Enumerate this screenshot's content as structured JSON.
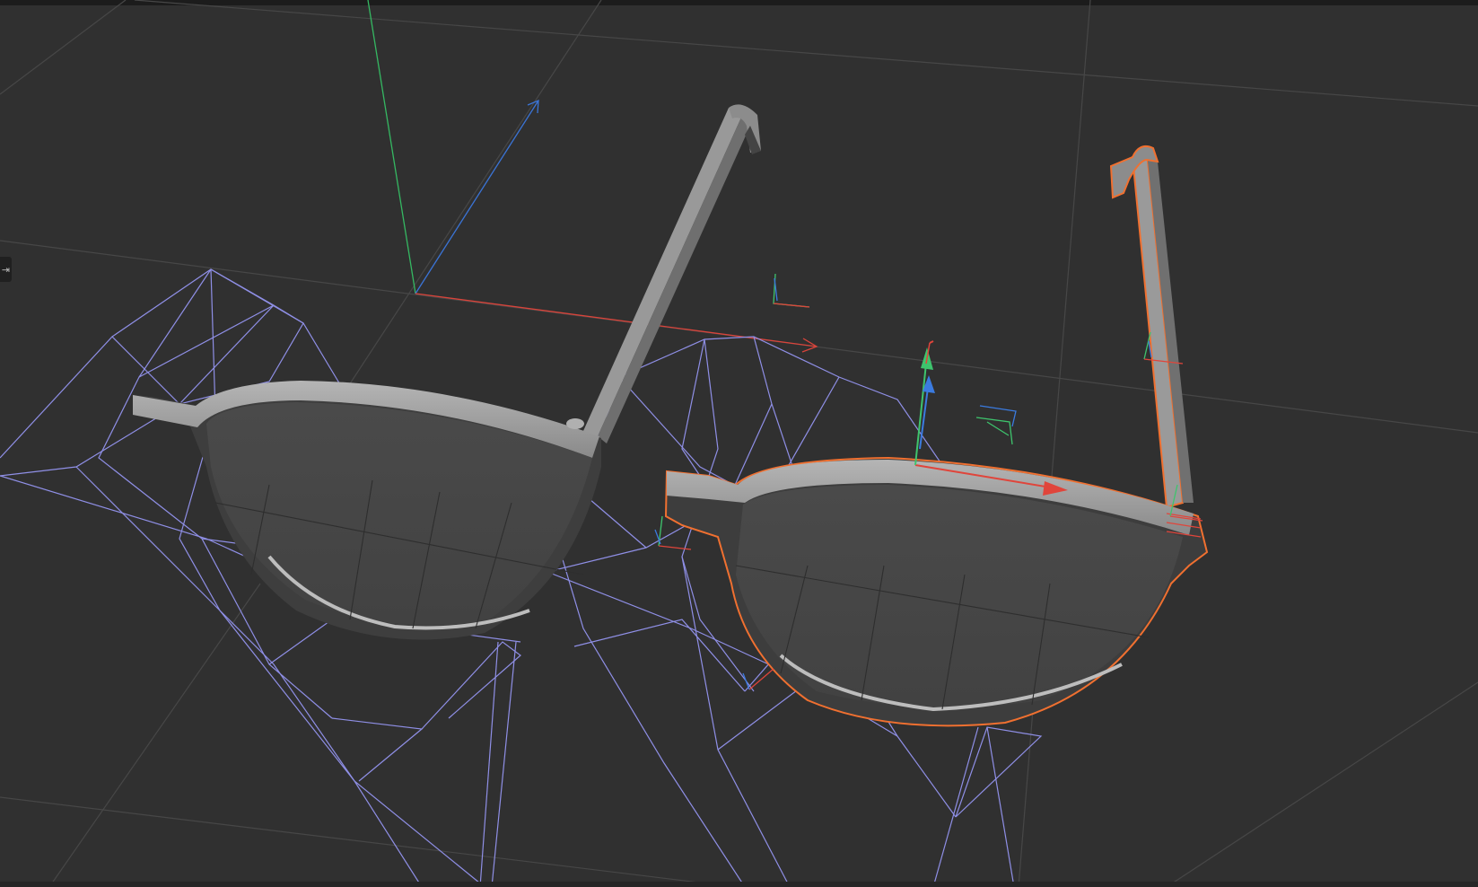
{
  "viewport": {
    "name": "3D Viewport",
    "background": "#303030"
  },
  "panel_toggle": {
    "icon": "arrow-right-to-line-icon",
    "glyph": "⇥"
  },
  "colors": {
    "grid": "#454545",
    "axis_x": "#e0453b",
    "axis_y": "#3ec46d",
    "axis_z": "#3b7be0",
    "wireframe": "#8f8fe6",
    "selection_outline": "#f07030",
    "frame_light": "#a7a7a7",
    "frame_mid": "#8c8c8c",
    "lens_fill": "#454545"
  },
  "scene": {
    "objects": [
      {
        "name": "left-lens-frame",
        "selected": false
      },
      {
        "name": "left-temple-arm",
        "selected": false
      },
      {
        "name": "right-lens-frame",
        "selected": true
      },
      {
        "name": "right-temple-arm",
        "selected": true
      },
      {
        "name": "left-wire-cage",
        "selected": false
      },
      {
        "name": "right-wire-cage",
        "selected": false
      }
    ],
    "gizmo": {
      "mode": "move",
      "axes": [
        "x",
        "y",
        "z"
      ]
    }
  }
}
